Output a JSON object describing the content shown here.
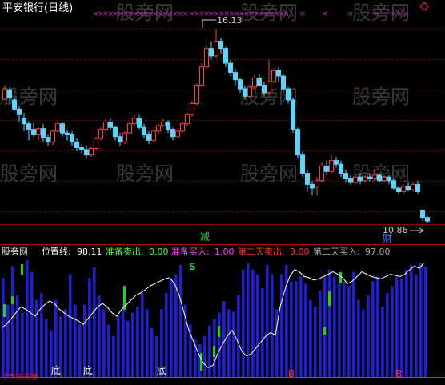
{
  "window": {
    "stock_title": "平安银行(日线)"
  },
  "watermark": {
    "text": "股旁网"
  },
  "price_panel": {
    "high_label": "16.13",
    "low_label": "10.86",
    "marker_reduce": "减",
    "marker_wealth": "财",
    "candles": [
      [
        14.22,
        14.48,
        14.6,
        14.18
      ],
      [
        14.48,
        14.25,
        14.55,
        14.1
      ],
      [
        14.2,
        13.95,
        14.28,
        13.9
      ],
      [
        13.95,
        13.8,
        14.05,
        13.6
      ],
      [
        13.7,
        13.55,
        13.85,
        13.35
      ],
      [
        13.55,
        13.4,
        13.62,
        13.1
      ],
      [
        13.4,
        13.25,
        13.58,
        13.2
      ],
      [
        13.25,
        13.42,
        13.45,
        13.1
      ],
      [
        13.42,
        13.18,
        13.55,
        13.05
      ],
      [
        13.18,
        13.05,
        13.25,
        12.95
      ],
      [
        13.05,
        13.35,
        13.4,
        12.98
      ],
      [
        13.35,
        13.55,
        13.62,
        13.3
      ],
      [
        13.55,
        13.3,
        13.6,
        13.2
      ],
      [
        13.3,
        13.25,
        13.4,
        13.1
      ],
      [
        13.25,
        13.05,
        13.35,
        12.95
      ],
      [
        13.05,
        12.9,
        13.15,
        12.8
      ],
      [
        12.9,
        12.85,
        12.98,
        12.75
      ],
      [
        12.85,
        12.7,
        12.95,
        12.6
      ],
      [
        12.7,
        12.88,
        12.92,
        12.65
      ],
      [
        12.88,
        13.15,
        13.2,
        12.85
      ],
      [
        13.15,
        13.4,
        13.45,
        13.1
      ],
      [
        13.4,
        13.6,
        13.66,
        13.35
      ],
      [
        13.6,
        13.45,
        13.7,
        13.38
      ],
      [
        13.45,
        13.2,
        13.5,
        13.1
      ],
      [
        13.2,
        13.05,
        13.3,
        12.95
      ],
      [
        13.05,
        13.3,
        13.35,
        13.0
      ],
      [
        13.3,
        13.55,
        13.62,
        13.25
      ],
      [
        13.55,
        13.7,
        13.78,
        13.5
      ],
      [
        13.7,
        13.45,
        13.8,
        13.4
      ],
      [
        13.45,
        13.25,
        13.55,
        13.15
      ],
      [
        13.25,
        13.1,
        13.35,
        13.0
      ],
      [
        13.1,
        13.35,
        13.4,
        13.05
      ],
      [
        13.35,
        13.5,
        13.55,
        13.25
      ],
      [
        13.5,
        13.6,
        13.68,
        13.45
      ],
      [
        13.6,
        13.4,
        13.65,
        13.3
      ],
      [
        13.4,
        13.2,
        13.45,
        13.1
      ],
      [
        13.2,
        13.35,
        13.4,
        13.15
      ],
      [
        13.35,
        13.55,
        13.6,
        13.3
      ],
      [
        13.55,
        13.8,
        13.85,
        13.5
      ],
      [
        13.8,
        14.1,
        14.18,
        13.75
      ],
      [
        14.1,
        14.6,
        14.65,
        14.05
      ],
      [
        14.6,
        15.1,
        15.2,
        14.55
      ],
      [
        15.1,
        15.6,
        15.7,
        15.05
      ],
      [
        15.6,
        15.4,
        15.8,
        15.3
      ],
      [
        15.4,
        15.8,
        16.13,
        15.35
      ],
      [
        15.8,
        15.6,
        15.9,
        15.45
      ],
      [
        15.6,
        15.2,
        15.65,
        15.1
      ],
      [
        15.2,
        14.95,
        15.3,
        14.85
      ],
      [
        14.95,
        14.75,
        15.05,
        14.6
      ],
      [
        14.75,
        14.5,
        14.8,
        14.4
      ],
      [
        14.5,
        14.3,
        14.6,
        14.2
      ],
      [
        14.3,
        14.55,
        14.62,
        14.25
      ],
      [
        14.55,
        14.8,
        14.88,
        14.5
      ],
      [
        14.8,
        14.6,
        14.9,
        14.55
      ],
      [
        14.6,
        14.4,
        14.7,
        14.3
      ],
      [
        14.4,
        14.7,
        15.3,
        14.35
      ],
      [
        14.7,
        15.0,
        15.05,
        14.65
      ],
      [
        15.0,
        14.85,
        15.1,
        14.7
      ],
      [
        14.85,
        14.5,
        14.9,
        14.4
      ],
      [
        14.5,
        14.2,
        14.55,
        14.1
      ],
      [
        14.2,
        13.4,
        14.25,
        13.3
      ],
      [
        13.4,
        12.7,
        13.45,
        12.6
      ],
      [
        12.7,
        12.2,
        12.8,
        12.1
      ],
      [
        12.2,
        11.9,
        12.3,
        11.7
      ],
      [
        11.9,
        11.8,
        12.0,
        11.6
      ],
      [
        11.85,
        12.0,
        12.1,
        11.6
      ],
      [
        12.0,
        12.4,
        12.5,
        11.95
      ],
      [
        12.4,
        12.25,
        12.55,
        12.15
      ],
      [
        12.25,
        12.55,
        12.7,
        12.2
      ],
      [
        12.55,
        12.45,
        12.65,
        12.35
      ],
      [
        12.45,
        12.2,
        12.55,
        12.1
      ],
      [
        12.2,
        12.05,
        12.3,
        11.95
      ],
      [
        12.05,
        11.95,
        12.15,
        11.88
      ],
      [
        11.95,
        12.1,
        12.15,
        11.9
      ],
      [
        12.1,
        12.0,
        12.2,
        11.9
      ],
      [
        12.0,
        12.1,
        12.15,
        11.95
      ],
      [
        12.1,
        12.05,
        12.2,
        12.0
      ],
      [
        12.05,
        12.15,
        12.3,
        12.0
      ],
      [
        12.15,
        12.0,
        12.2,
        11.95
      ],
      [
        12.0,
        12.1,
        12.15,
        11.95
      ],
      [
        12.1,
        12.0,
        12.15,
        11.9
      ],
      [
        12.0,
        11.8,
        12.05,
        11.75
      ],
      [
        11.8,
        11.7,
        11.85,
        11.65
      ],
      [
        11.7,
        11.85,
        11.9,
        11.65
      ],
      [
        11.85,
        11.75,
        11.95,
        11.7
      ],
      [
        11.75,
        11.9,
        11.95,
        11.7
      ],
      [
        11.9,
        11.7,
        12.0,
        11.65
      ],
      [
        11.2,
        11.0,
        11.22,
        10.92
      ],
      [
        11.0,
        10.9,
        11.05,
        10.86
      ]
    ]
  },
  "indicator_panel": {
    "watermark_label": "股旁网",
    "position_line_label": "位置线:",
    "position_line_value": "98.11",
    "ready_sell_label": "准备卖出:",
    "ready_sell_value": "0.00",
    "ready_buy_label": "准备买入:",
    "ready_buy_value": "1.00",
    "second_day_sell_label": "第二天卖出:",
    "second_day_sell_value": "3.00",
    "second_day_buy_label": "第二天买入:",
    "second_day_buy_value": "97.00",
    "marker_sell": "S",
    "bottom_markers": [
      "底",
      "底",
      "底"
    ],
    "buy_markers": [
      "B",
      "B"
    ],
    "bottom_left_text": "手到天天赚",
    "position_series": [
      42,
      45,
      50,
      55,
      60,
      58,
      55,
      52,
      58,
      62,
      65,
      63,
      58,
      55,
      52,
      50,
      48,
      45,
      50,
      55,
      60,
      63,
      60,
      55,
      52,
      58,
      62,
      66,
      70,
      72,
      75,
      78,
      80,
      82,
      84,
      85,
      80,
      70,
      55,
      40,
      30,
      20,
      12,
      8,
      10,
      20,
      28,
      35,
      40,
      32,
      22,
      18,
      20,
      25,
      30,
      35,
      38,
      36,
      60,
      75,
      86,
      92,
      90,
      86,
      85,
      83,
      84,
      86,
      88,
      90,
      88,
      85,
      80,
      82,
      86,
      90,
      88,
      86,
      85,
      84,
      86,
      88,
      87,
      86,
      88,
      92,
      95,
      93,
      98
    ],
    "bar_values": [
      85,
      62,
      95,
      70,
      55,
      100,
      90,
      66,
      72,
      50,
      40,
      66,
      52,
      58,
      88,
      62,
      45,
      62,
      85,
      94,
      70,
      58,
      45,
      35,
      52,
      60,
      48,
      55,
      60,
      72,
      58,
      42,
      35,
      58,
      72,
      84,
      88,
      96,
      62,
      45,
      32,
      28,
      35,
      44,
      50,
      55,
      65,
      58,
      56,
      70,
      92,
      98,
      92,
      88,
      76,
      96,
      88,
      58,
      88,
      96,
      82,
      82,
      86,
      80,
      66,
      60,
      74,
      86,
      92,
      86,
      80,
      82,
      78,
      90,
      66,
      58,
      70,
      82,
      86,
      60,
      72,
      78,
      86,
      84,
      92,
      96,
      88,
      98,
      94
    ]
  }
}
